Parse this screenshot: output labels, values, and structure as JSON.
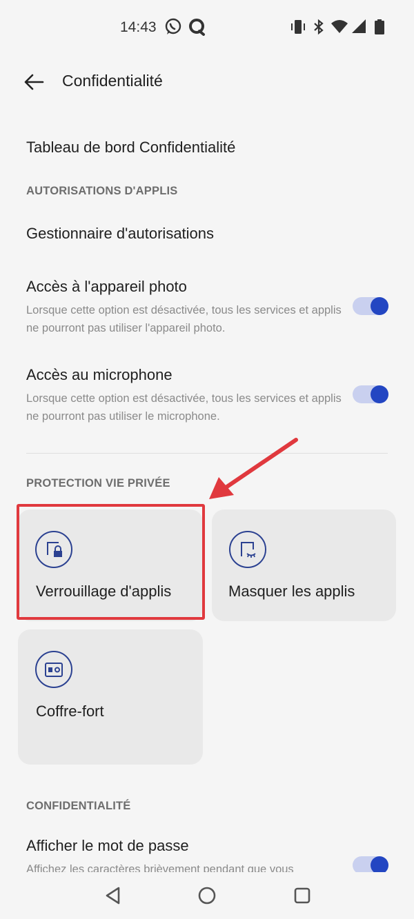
{
  "status_bar": {
    "time": "14:43",
    "left_icons": [
      "whatsapp-icon",
      "chat-bubble-icon"
    ],
    "right_icons": [
      "vibrate-icon",
      "bluetooth-icon",
      "wifi-icon",
      "signal-icon",
      "battery-icon"
    ]
  },
  "toolbar": {
    "title": "Confidentialité",
    "back_icon": "arrow-left-icon"
  },
  "items": {
    "dashboard": "Tableau de bord Confidentialité",
    "section_permissions": "AUTORISATIONS D'APPLIS",
    "permission_manager": "Gestionnaire d'autorisations",
    "camera": {
      "title": "Accès à l'appareil photo",
      "desc": "Lorsque cette option est désactivée, tous les services et applis ne pourront pas utiliser l'appareil photo.",
      "enabled": true
    },
    "microphone": {
      "title": "Accès au microphone",
      "desc": "Lorsque cette option est désactivée, tous les services et applis ne pourront pas utiliser le microphone.",
      "enabled": true
    },
    "section_protection": "PROTECTION VIE PRIVÉE",
    "cards": [
      {
        "label": "Verrouillage d'applis",
        "icon": "app-lock-icon"
      },
      {
        "label": "Masquer les applis",
        "icon": "hide-apps-icon"
      },
      {
        "label": "Coffre-fort",
        "icon": "safe-icon"
      }
    ],
    "section_privacy": "CONFIDENTIALITÉ",
    "show_password": {
      "title": "Afficher le mot de passe",
      "desc": "Affichez les caractères brièvement pendant que vous",
      "enabled": true
    }
  },
  "colors": {
    "accent": "#2346c2",
    "toggle_track": "#c9d0ef",
    "highlight": "#e0393e",
    "card_bg": "#e9e9e9"
  },
  "nav_bar": [
    "back-triangle-icon",
    "home-circle-icon",
    "recents-square-icon"
  ]
}
